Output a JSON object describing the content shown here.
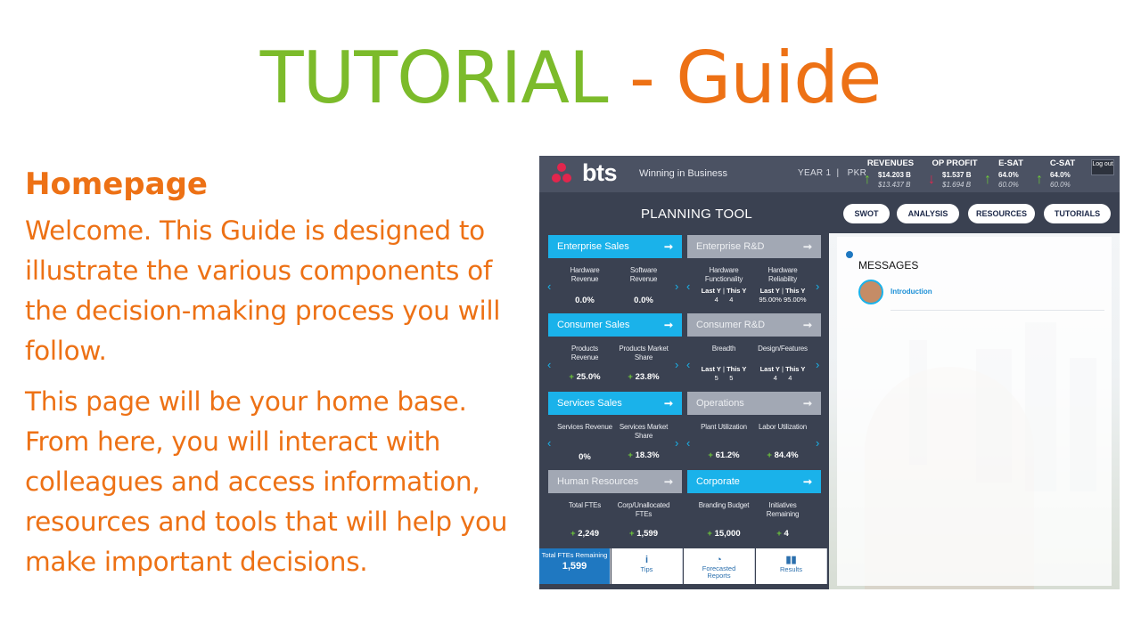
{
  "slide": {
    "title_part1": "TUTORIAL",
    "title_sep": " - ",
    "title_part2": "Guide",
    "heading": "Homepage",
    "paragraphs": [
      "Welcome. This Guide is designed to illustrate the various components of the decision-making process you will follow.",
      "This page will be your home base. From here, you will interact with colleagues and access information, resources and tools that will help you make important decisions."
    ],
    "colors": {
      "green": "#7cbb2b",
      "orange": "#ed7115"
    }
  },
  "app": {
    "logo": "bts",
    "tagline": "Winning in Business",
    "year": "YEAR 1",
    "team": "PKR",
    "logout": "Log out",
    "kpis": [
      {
        "label": "REVENUES",
        "value": "$14.203 B",
        "prev": "$13.437 B",
        "trend": "up"
      },
      {
        "label": "OP PROFIT",
        "value": "$1.537 B",
        "prev": "$1.694 B",
        "trend": "down"
      },
      {
        "label": "E-SAT",
        "value": "64.0%",
        "prev": "60.0%",
        "trend": "up"
      },
      {
        "label": "C-SAT",
        "value": "64.0%",
        "prev": "60.0%",
        "trend": "up"
      }
    ],
    "planning_title": "PLANNING TOOL",
    "nav_buttons": [
      "SWOT",
      "ANALYSIS",
      "RESOURCES",
      "TUTORIALS"
    ],
    "cards": [
      {
        "title": "Enterprise Sales",
        "active": true,
        "metrics": [
          {
            "label": "Hardware Revenue",
            "value": "0.0%"
          },
          {
            "label": "Software Revenue",
            "value": "0.0%"
          }
        ]
      },
      {
        "title": "Enterprise R&D",
        "active": false,
        "metrics": [
          {
            "label": "Hardware Functionality",
            "ly": "4",
            "ty": "4"
          },
          {
            "label": "Hardware Reliability",
            "ly": "95.00%",
            "ty": "95.00%"
          }
        ]
      },
      {
        "title": "Consumer Sales",
        "active": true,
        "metrics": [
          {
            "label": "Products Revenue",
            "value": "25.0%"
          },
          {
            "label": "Products Market Share",
            "value": "23.8%"
          }
        ]
      },
      {
        "title": "Consumer R&D",
        "active": false,
        "metrics": [
          {
            "label": "Breadth",
            "ly": "5",
            "ty": "5"
          },
          {
            "label": "Design/Features",
            "ly": "4",
            "ty": "4"
          }
        ]
      },
      {
        "title": "Services Sales",
        "active": true,
        "metrics": [
          {
            "label": "Services Revenue",
            "value": "0%"
          },
          {
            "label": "Services Market Share",
            "value": "18.3%"
          }
        ]
      },
      {
        "title": "Operations",
        "active": false,
        "metrics": [
          {
            "label": "Plant Utilization",
            "value": "61.2%"
          },
          {
            "label": "Labor Utilization",
            "value": "84.4%"
          }
        ]
      },
      {
        "title": "Human Resources",
        "active": false,
        "metrics": [
          {
            "label": "Total FTEs",
            "value": "2,249"
          },
          {
            "label": "Corp/Unallocated FTEs",
            "value": "1,599"
          }
        ]
      },
      {
        "title": "Corporate",
        "active": true,
        "metrics": [
          {
            "label": "Branding Budget",
            "value": "15,000"
          },
          {
            "label": "Initiatives Remaining",
            "value": "4"
          }
        ]
      }
    ],
    "ly_label": "Last Y",
    "ty_label": "This Y",
    "bottom_buttons": [
      {
        "label": "Total FTEs Remaining",
        "value": "1,599",
        "icon": "people-icon"
      },
      {
        "label": "Tips",
        "icon": "info-icon"
      },
      {
        "label": "Forecasted Reports",
        "icon": "pie-chart-icon"
      },
      {
        "label": "Results",
        "icon": "bar-chart-icon"
      }
    ],
    "messages_title": "MESSAGES",
    "message_items": [
      "Introduction"
    ],
    "colors": {
      "accent": "#1ab2ea",
      "panel": "#3a4151",
      "positive": "#6ec83a",
      "negative": "#e2264d"
    }
  }
}
